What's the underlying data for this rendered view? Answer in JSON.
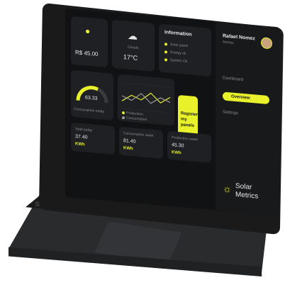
{
  "user": {
    "name": "Rafael Nomez",
    "role": "Nomez"
  },
  "sidebar": {
    "items": [
      {
        "label": "Dashboard",
        "active": false
      },
      {
        "label": "Overview",
        "active": true
      },
      {
        "label": "Settings",
        "active": false
      }
    ]
  },
  "brand": {
    "line1": "Solar",
    "line2": "Metrics"
  },
  "cards": {
    "money": {
      "value": "R$ 45.00",
      "icon": "coins-icon"
    },
    "weather": {
      "value": "17°C",
      "label": "Clouds",
      "icon": "cloud-icon"
    },
    "info": {
      "title": "Information",
      "items": [
        "Solar panel",
        "Energy ok",
        "System Ok"
      ]
    },
    "gauge": {
      "value": "63.33",
      "label": "Consumption today"
    },
    "chart": {
      "legend": [
        "Production",
        "Consumption"
      ]
    },
    "cta": {
      "text": "Register my panels"
    },
    "stats": [
      {
        "title": "Total today",
        "value": "37.40",
        "unit": "KWh"
      },
      {
        "title": "Consumption week",
        "value": "81.40",
        "unit": "KWh"
      },
      {
        "title": "Production week",
        "value": "45.30",
        "unit": "KWh"
      }
    ]
  },
  "colors": {
    "accent": "#e8f12a",
    "panel": "#1f2023",
    "background": "#111214"
  },
  "chart_data": {
    "type": "line",
    "x": [
      1,
      2,
      3,
      4,
      5,
      6
    ],
    "series": [
      {
        "name": "Production",
        "values": [
          30,
          55,
          40,
          70,
          35,
          60
        ]
      },
      {
        "name": "Consumption",
        "values": [
          50,
          35,
          65,
          30,
          55,
          40
        ]
      }
    ],
    "ylim": [
      0,
      100
    ]
  }
}
